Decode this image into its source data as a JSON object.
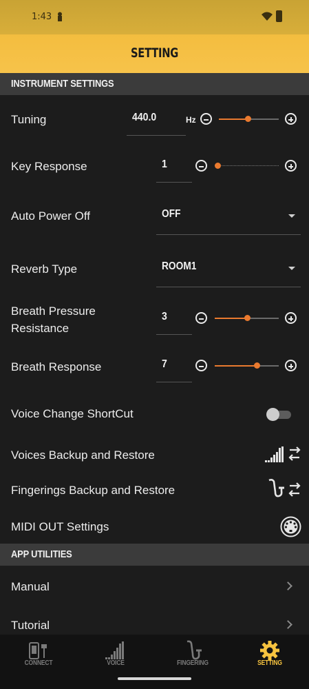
{
  "status_bar": {
    "time": "1:43"
  },
  "header": {
    "title": "SETTING"
  },
  "sections": {
    "instrument": "INSTRUMENT SETTINGS",
    "app_utilities": "APP UTILITIES"
  },
  "settings": {
    "tuning": {
      "label": "Tuning",
      "value": "440.0",
      "unit": "Hz",
      "level": 0.48
    },
    "key_response": {
      "label": "Key Response",
      "value": "1",
      "level": 0.0
    },
    "auto_power_off": {
      "label": "Auto Power Off",
      "value": "OFF"
    },
    "reverb_type": {
      "label": "Reverb Type",
      "value": "ROOM1"
    },
    "breath_pressure": {
      "label_line1": "Breath Pressure",
      "label_line2": "Resistance",
      "value": "3",
      "level": 0.5
    },
    "breath_response": {
      "label": "Breath Response",
      "value": "7",
      "level": 0.66
    },
    "voice_change_shortcut": {
      "label": "Voice Change ShortCut",
      "enabled": false
    },
    "voices_backup": {
      "label": "Voices Backup and Restore",
      "icon": "voices-transfer-icon"
    },
    "fingerings_backup": {
      "label": "Fingerings Backup and Restore",
      "icon": "sax-transfer-icon"
    },
    "midi_out": {
      "label": "MIDI OUT Settings",
      "icon": "midi-din-icon"
    }
  },
  "utilities": {
    "manual": {
      "label": "Manual"
    },
    "tutorial": {
      "label": "Tutorial"
    }
  },
  "nav": {
    "items": [
      {
        "label": "CONNECT",
        "icon": "device-connect-icon",
        "active": false
      },
      {
        "label": "VOICE",
        "icon": "voice-bars-icon",
        "active": false
      },
      {
        "label": "FINGERING",
        "icon": "saxophone-icon",
        "active": false
      },
      {
        "label": "SETTING",
        "icon": "gear-icon",
        "active": true
      }
    ]
  },
  "colors": {
    "accent": "#ea7a2f",
    "header": "#f7c34a",
    "active_nav": "#f6c33f",
    "background": "#1c1c1c",
    "section": "#3b3b3b"
  }
}
